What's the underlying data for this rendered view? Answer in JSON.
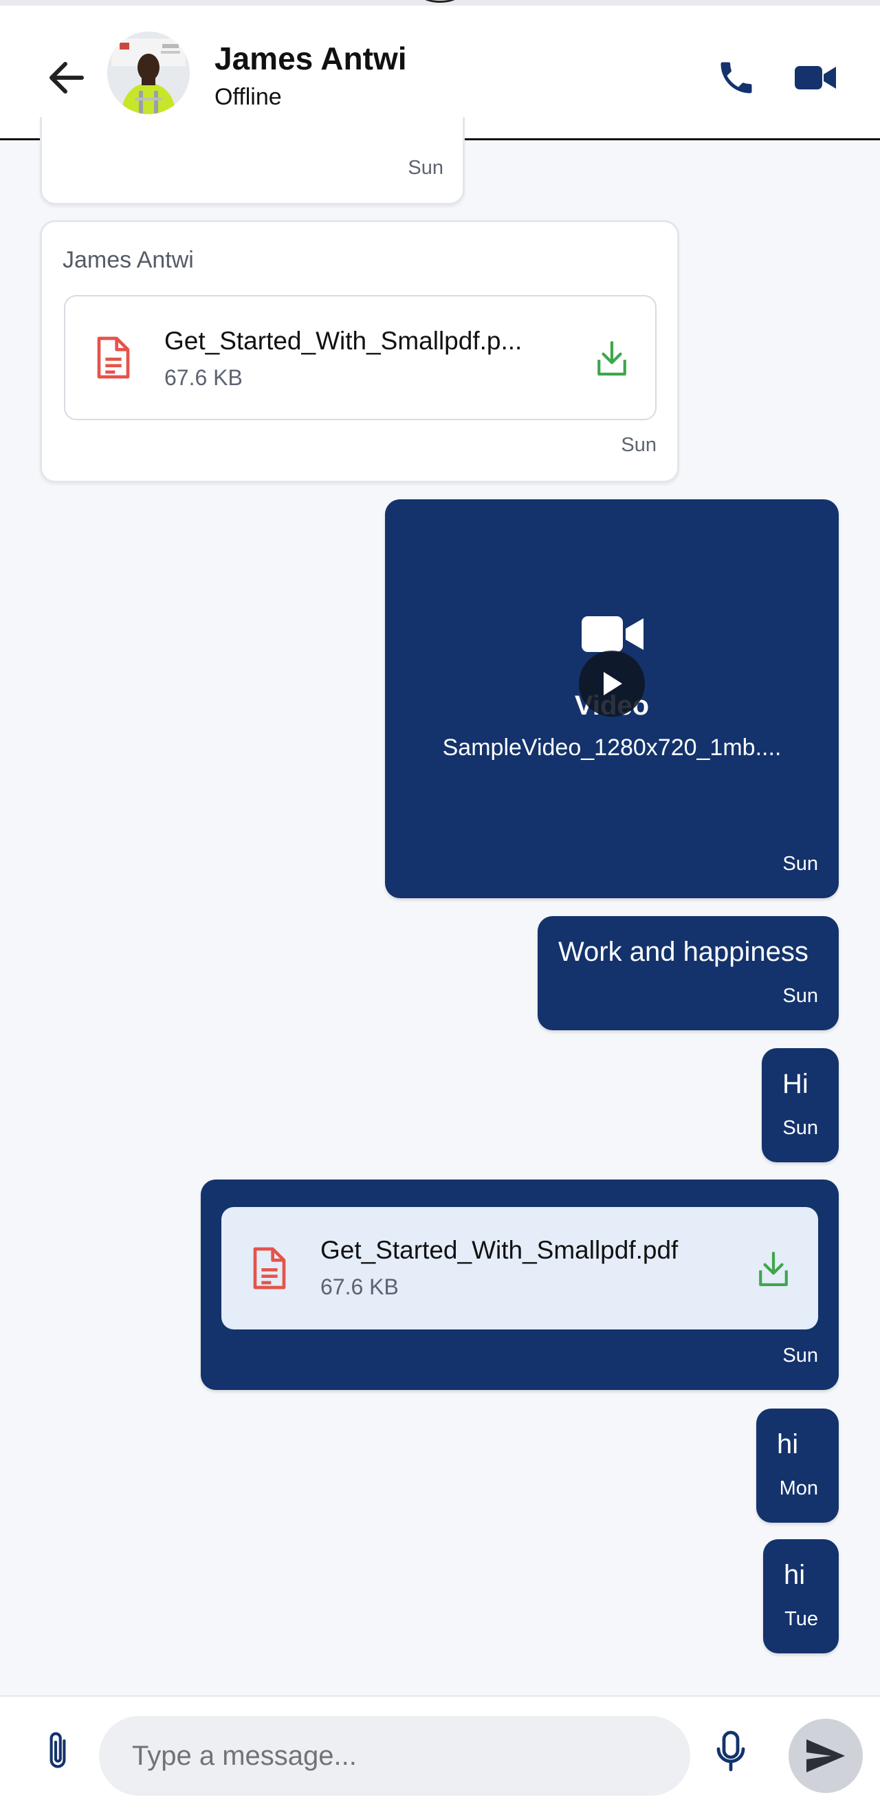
{
  "header": {
    "contact_name": "James Antwi",
    "status": "Offline"
  },
  "messages": {
    "m0": {
      "time": "Sun"
    },
    "m1": {
      "sender": "James Antwi",
      "file_name": "Get_Started_With_Smallpdf.p...",
      "file_size": "67.6 KB",
      "time": "Sun"
    },
    "m2": {
      "label": "Video",
      "file_name": "SampleVideo_1280x720_1mb....",
      "time": "Sun"
    },
    "m3": {
      "text": "Work and happiness",
      "time": "Sun"
    },
    "m4": {
      "text": "Hi",
      "time": "Sun"
    },
    "m5": {
      "file_name": "Get_Started_With_Smallpdf.pdf",
      "file_size": "67.6 KB",
      "time": "Sun"
    },
    "m6": {
      "text": "hi",
      "time": "Mon"
    },
    "m7": {
      "text": "hi",
      "time": "Tue"
    }
  },
  "composer": {
    "placeholder": "Type a message..."
  },
  "colors": {
    "outgoing_bubble": "#14336c",
    "incoming_bubble": "#ffffff",
    "accent": "#14336c",
    "pdf_icon": "#e5534b",
    "download_icon": "#3fa64a"
  },
  "icons": [
    "back-arrow-icon",
    "phone-icon",
    "video-camera-icon",
    "pdf-file-icon",
    "download-icon",
    "play-icon",
    "paperclip-icon",
    "microphone-icon",
    "send-icon"
  ]
}
